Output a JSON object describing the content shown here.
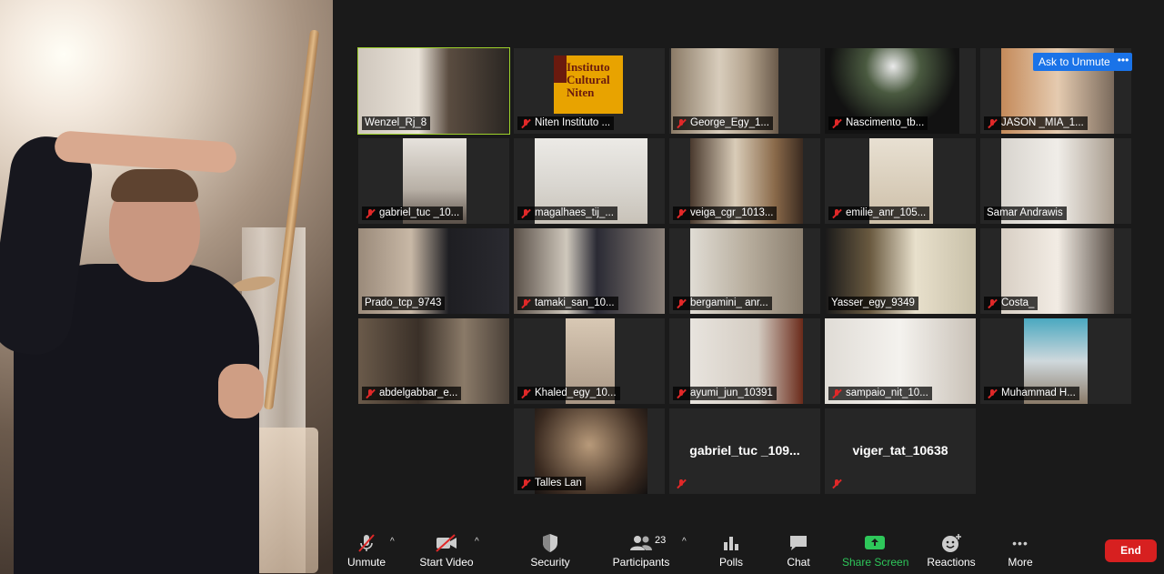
{
  "ask_unmute": "Ask to Unmute",
  "more_dots": "•••",
  "logo_text": "Instituto Cultural Niten",
  "tiles": [
    {
      "name": "Wenzel_Rj_8",
      "muted": false
    },
    {
      "name": "Niten Instituto ...",
      "muted": true
    },
    {
      "name": "George_Egy_1...",
      "muted": true
    },
    {
      "name": "Nascimento_tb...",
      "muted": true
    },
    {
      "name": "JASON _MIA_1...",
      "muted": true
    },
    {
      "name": "gabriel_tuc _10...",
      "muted": true
    },
    {
      "name": "magalhaes_tij_...",
      "muted": true
    },
    {
      "name": "veiga_cgr_1013...",
      "muted": true
    },
    {
      "name": "emilie_anr_105...",
      "muted": true
    },
    {
      "name": "Samar Andrawis",
      "muted": false
    },
    {
      "name": "Prado_tcp_9743",
      "muted": false
    },
    {
      "name": "tamaki_san_10...",
      "muted": true
    },
    {
      "name": "bergamini_ anr...",
      "muted": true
    },
    {
      "name": "Yasser_egy_9349",
      "muted": false
    },
    {
      "name": "Costa_",
      "muted": true
    },
    {
      "name": "abdelgabbar_e...",
      "muted": true
    },
    {
      "name": "Khaled_egy_10...",
      "muted": true
    },
    {
      "name": "ayumi_jun_10391",
      "muted": true
    },
    {
      "name": "sampaio_nit_10...",
      "muted": true
    },
    {
      "name": "Muhammad H...",
      "muted": true
    },
    {
      "name": "Talles Lan",
      "muted": true
    },
    {
      "name": "gabriel_tuc  _109...",
      "muted": true
    },
    {
      "name": "viger_tat_10638",
      "muted": true
    }
  ],
  "toolbar": {
    "unmute": "Unmute",
    "start_video": "Start Video",
    "security": "Security",
    "participants": "Participants",
    "participants_count": "23",
    "polls": "Polls",
    "chat": "Chat",
    "share_screen": "Share Screen",
    "reactions": "Reactions",
    "more": "More",
    "end": "End"
  },
  "colors": {
    "share": "#2ec75a",
    "end": "#d72020",
    "active_border": "#9dd12b",
    "ask": "#1a73e8"
  }
}
